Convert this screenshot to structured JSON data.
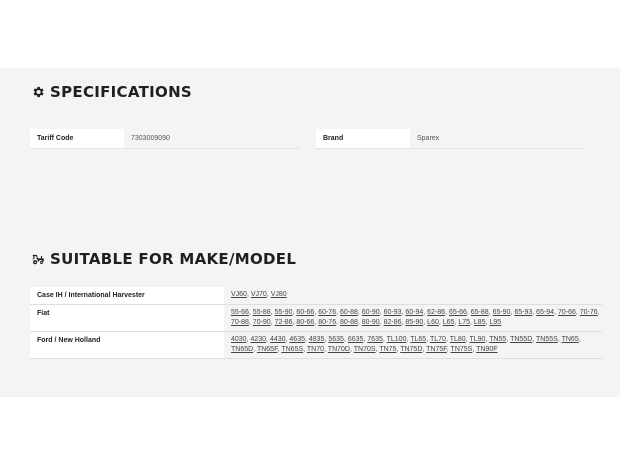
{
  "specifications": {
    "heading": "SPECIFICATIONS",
    "icon": "gear-icon",
    "rows": [
      {
        "label": "Tariff Code",
        "value": "7303009090"
      },
      {
        "label": "Brand",
        "value": "Sparex"
      }
    ]
  },
  "suitable": {
    "heading": "SUITABLE FOR MAKE/MODEL",
    "icon": "tractor-icon",
    "makes": [
      {
        "make": "Case IH / International Harvester",
        "models": [
          "VJ60",
          "VJ70",
          "VJ80"
        ]
      },
      {
        "make": "Fiat",
        "models": [
          "55-66",
          "55-88",
          "55-90",
          "60-66",
          "60-76",
          "60-88",
          "60-90",
          "60-93",
          "60-94",
          "62-86",
          "65-66",
          "65-88",
          "65-90",
          "65-93",
          "65-94",
          "70-66",
          "70-76",
          "70-88",
          "70-90",
          "72-86",
          "80-66",
          "80-76",
          "80-88",
          "80-90",
          "82-86",
          "85-90",
          "L60",
          "L65",
          "L75",
          "L85",
          "L95"
        ]
      },
      {
        "make": "Ford / New Holland",
        "models": [
          "4030",
          "4230",
          "4430",
          "4635",
          "4835",
          "5635",
          "6635",
          "7635",
          "TL100",
          "TL65",
          "TL70",
          "TL80",
          "TL90",
          "TN55",
          "TN55D",
          "TN55S",
          "TN65",
          "TN65D",
          "TN65F",
          "TN65S",
          "TN70",
          "TN70D",
          "TN70S",
          "TN75",
          "TN75D",
          "TN75F",
          "TN75S",
          "TN90F"
        ]
      }
    ]
  },
  "colors": {
    "band": "#f4f4f4",
    "heading": "#1f1f1f",
    "link": "#444444"
  }
}
